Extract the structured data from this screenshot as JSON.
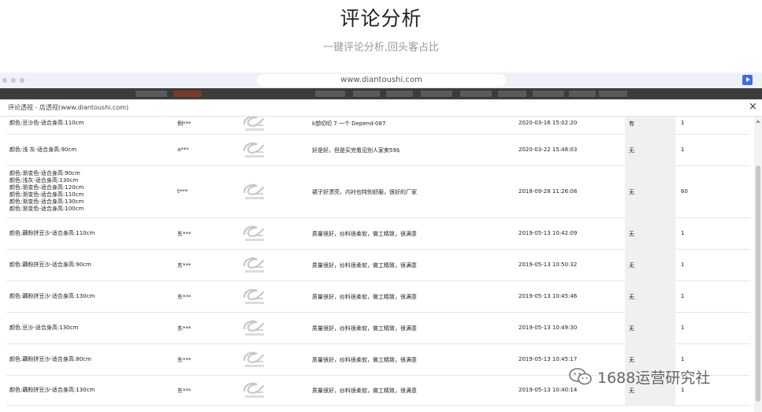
{
  "page": {
    "title": "评论分析",
    "subtitle": "一键评论分析,回头客占比"
  },
  "browser": {
    "url": "www.diantoushi.com"
  },
  "panel": {
    "title": "评论透视 - 店透视(www.diantoushi.com)",
    "close": "×"
  },
  "rows": [
    {
      "spec": [
        "颜色:豆沙色-适合身高:110cm"
      ],
      "user": "例***",
      "comment": "k想叨叨 7 一个 Depend-087",
      "time": "2020-03-16 15:02:20",
      "reply": "有",
      "count": "1"
    },
    {
      "spec": [
        "颜色:浅 灰-适合身高:90cm"
      ],
      "user": "a***",
      "comment": "好是好，但是买完看见别人家卖59$",
      "time": "2020-03-22 15:48:03",
      "reply": "无",
      "count": "1"
    },
    {
      "spec": [
        "颜色:渐变色-适合身高:90cm",
        "颜色:浅灰-适合身高:130cm",
        "颜色:渐变色-适合身高:120cm",
        "颜色:渐变色-适合身高:110cm",
        "颜色:渐变色-适合身高:130cm",
        "颜色:渐变色-适合身高:100cm"
      ],
      "user": "t***",
      "comment": "裙子好漂亮，内衬也特别舒服，很好的厂家",
      "time": "2018-09-28 11:26:08",
      "reply": "无",
      "count": "60"
    },
    {
      "spec": [
        "颜色:藕粉拼豆沙-适合身高:110cm"
      ],
      "user": "东***",
      "comment": "质量很好，纱料很柔软，做工精致，很满意",
      "time": "2019-05-13 10:42:09",
      "reply": "无",
      "count": "1"
    },
    {
      "spec": [
        "颜色:藕粉拼豆沙-适合身高:90cm"
      ],
      "user": "东***",
      "comment": "质量很好，纱料很柔软，做工精致，很满意",
      "time": "2019-05-13 10:50:32",
      "reply": "无",
      "count": "1"
    },
    {
      "spec": [
        "颜色:藕粉拼豆沙-适合身高:130cm"
      ],
      "user": "东***",
      "comment": "质量很好，纱料很柔软，做工精致，很满意",
      "time": "2019-05-13 10:45:46",
      "reply": "无",
      "count": "1"
    },
    {
      "spec": [
        "颜色:豆沙-适合身高:130cm"
      ],
      "user": "东***",
      "comment": "质量很好，纱料很柔软，做工精致，很满意",
      "time": "2019-05-13 10:49:30",
      "reply": "无",
      "count": "1"
    },
    {
      "spec": [
        "颜色:藕粉拼豆沙-适合身高:80cm"
      ],
      "user": "东***",
      "comment": "质量很好，纱料很柔软，做工精致，很满意",
      "time": "2019-05-13 10:45:17",
      "reply": "无",
      "count": "1"
    },
    {
      "spec": [
        "颜色:藕粉拼豆沙-适合身高:130cm"
      ],
      "user": "东***",
      "comment": "质量很好，纱料很柔软，做工精致，很满意",
      "time": "2019-05-13 10:40:14",
      "reply": "无",
      "count": "1"
    }
  ],
  "watermark": {
    "text": "1688运营研究社"
  }
}
